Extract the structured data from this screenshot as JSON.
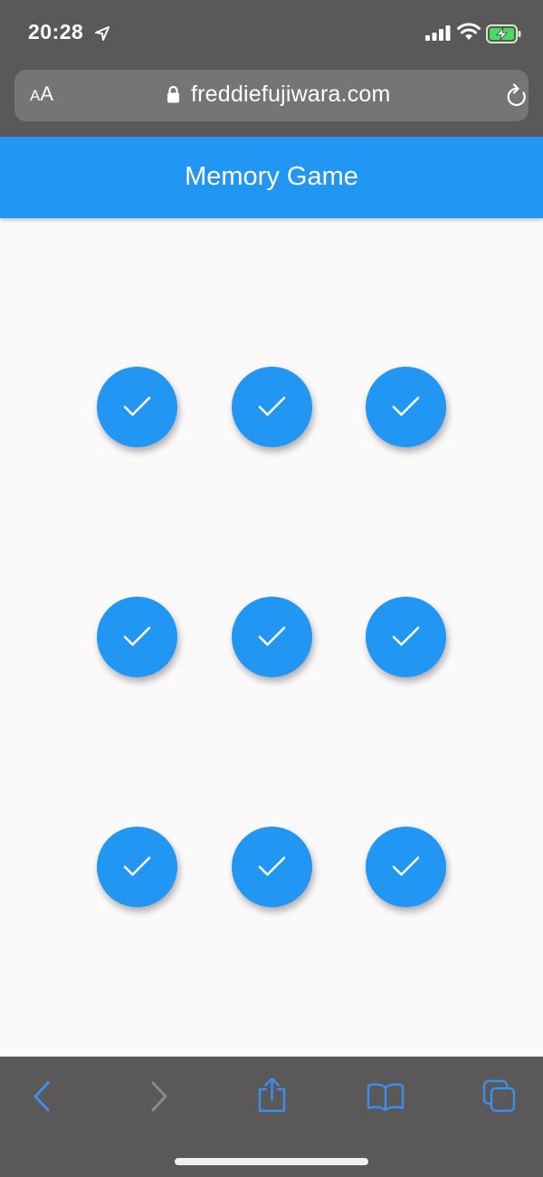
{
  "status_bar": {
    "time": "20:28",
    "icons": [
      "location-arrow-icon",
      "signal-icon",
      "wifi-icon",
      "battery-charging-icon"
    ]
  },
  "browser": {
    "aa_label_small": "A",
    "aa_label_large": "A",
    "url": "freddiefujiwara.com",
    "icons": [
      "lock-icon",
      "reload-icon"
    ]
  },
  "app": {
    "title": "Memory Game",
    "accent_color": "#2196f3",
    "tiles": [
      {
        "state": "matched",
        "icon": "check-icon"
      },
      {
        "state": "matched",
        "icon": "check-icon"
      },
      {
        "state": "matched",
        "icon": "check-icon"
      },
      {
        "state": "matched",
        "icon": "check-icon"
      },
      {
        "state": "matched",
        "icon": "check-icon"
      },
      {
        "state": "matched",
        "icon": "check-icon"
      },
      {
        "state": "matched",
        "icon": "check-icon"
      },
      {
        "state": "matched",
        "icon": "check-icon"
      },
      {
        "state": "matched",
        "icon": "check-icon"
      }
    ]
  },
  "toolbar": {
    "buttons": [
      "back-icon",
      "forward-icon",
      "share-icon",
      "bookmarks-icon",
      "tabs-icon"
    ],
    "active_color": "#3a8ef0",
    "disabled_color": "#8a8a8a"
  }
}
